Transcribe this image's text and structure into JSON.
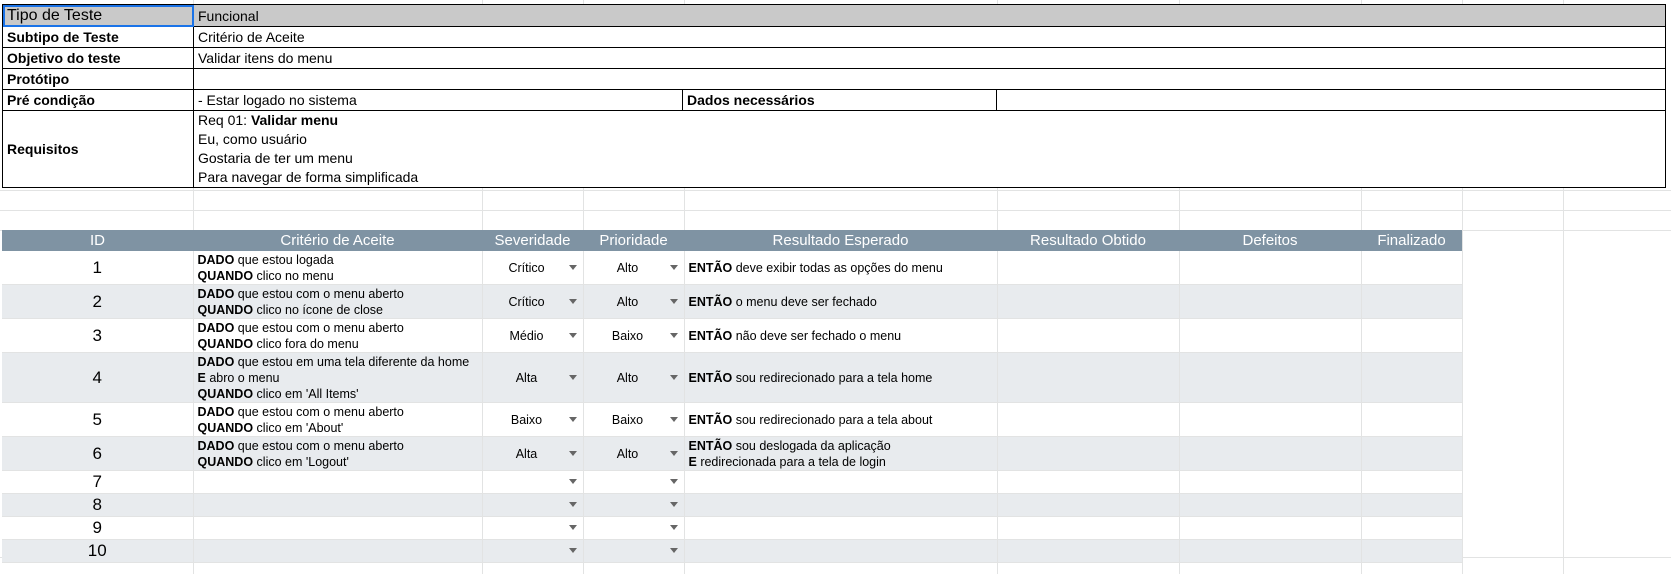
{
  "info": {
    "tipo_label": "Tipo de Teste",
    "tipo_value": "Funcional",
    "subtipo_label": "Subtipo de Teste",
    "subtipo_value": "Critério de Aceite",
    "objetivo_label": "Objetivo do teste",
    "objetivo_value": "Validar itens do menu",
    "prototipo_label": "Protótipo",
    "prototipo_value": "",
    "pre_label": "Pré condição",
    "pre_value": "- Estar logado no sistema",
    "dados_label": "Dados necessários",
    "dados_value": "",
    "req_label": "Requisitos",
    "req_prefix": "Req 01: ",
    "req_title": "Validar menu",
    "req_line2": "Eu, como usuário",
    "req_line3": "Gostaria de ter um menu",
    "req_line4": "Para navegar de forma simplificada"
  },
  "criteria": {
    "headers": {
      "id": "ID",
      "criterio": "Critério de Aceite",
      "severidade": "Severidade",
      "prioridade": "Prioridade",
      "esperado": "Resultado Esperado",
      "obtido": "Resultado Obtido",
      "defeitos": "Defeitos",
      "finalizado": "Finalizado"
    },
    "rows": [
      {
        "id": "1",
        "l1k": "DADO",
        "l1": " que estou logada",
        "l2k": "QUANDO",
        "l2": " clico no menu",
        "l3k": "",
        "l3": "",
        "l4k": "",
        "l4": "",
        "sev": "Crítico",
        "pri": "Alto",
        "e1k": "ENTÃO",
        "e1": " deve exibir todas as opções do menu",
        "e2k": "",
        "e2": ""
      },
      {
        "id": "2",
        "l1k": "DADO",
        "l1": " que estou com o menu aberto",
        "l2k": "QUANDO",
        "l2": " clico no ícone de close",
        "l3k": "",
        "l3": "",
        "l4k": "",
        "l4": "",
        "sev": "Crítico",
        "pri": "Alto",
        "e1k": "ENTÃO",
        "e1": " o menu deve ser fechado",
        "e2k": "",
        "e2": ""
      },
      {
        "id": "3",
        "l1k": "DADO",
        "l1": " que estou com o menu aberto",
        "l2k": "QUANDO",
        "l2": " clico fora do menu",
        "l3k": "",
        "l3": "",
        "l4k": "",
        "l4": "",
        "sev": "Médio",
        "pri": "Baixo",
        "e1k": "ENTÃO",
        "e1": " não deve ser fechado o menu",
        "e2k": "",
        "e2": ""
      },
      {
        "id": "4",
        "l1k": "DADO",
        "l1": " que estou em uma tela diferente da home",
        "l2k": "E",
        "l2": " abro o menu",
        "l3k": "QUANDO",
        "l3": " clico em 'All Items'",
        "l4k": "",
        "l4": "",
        "sev": "Alta",
        "pri": "Alto",
        "e1k": "ENTÃO",
        "e1": " sou redirecionado para a tela home",
        "e2k": "",
        "e2": ""
      },
      {
        "id": "5",
        "l1k": "DADO",
        "l1": " que estou com o menu aberto",
        "l2k": "QUANDO",
        "l2": " clico em 'About'",
        "l3k": "",
        "l3": "",
        "l4k": "",
        "l4": "",
        "sev": "Baixo",
        "pri": "Baixo",
        "e1k": "ENTÃO",
        "e1": " sou redirecionado para a tela about",
        "e2k": "",
        "e2": ""
      },
      {
        "id": "6",
        "l1k": "DADO",
        "l1": " que estou com o menu aberto",
        "l2k": "QUANDO",
        "l2": " clico em 'Logout'",
        "l3k": "",
        "l3": "",
        "l4k": "",
        "l4": "",
        "sev": "Alta",
        "pri": "Alto",
        "e1k": "ENTÃO",
        "e1": " sou deslogada da aplicação",
        "e2k": "E",
        "e2": " redirecionada para a tela de login"
      },
      {
        "id": "7"
      },
      {
        "id": "8"
      },
      {
        "id": "9"
      },
      {
        "id": "10"
      }
    ]
  }
}
